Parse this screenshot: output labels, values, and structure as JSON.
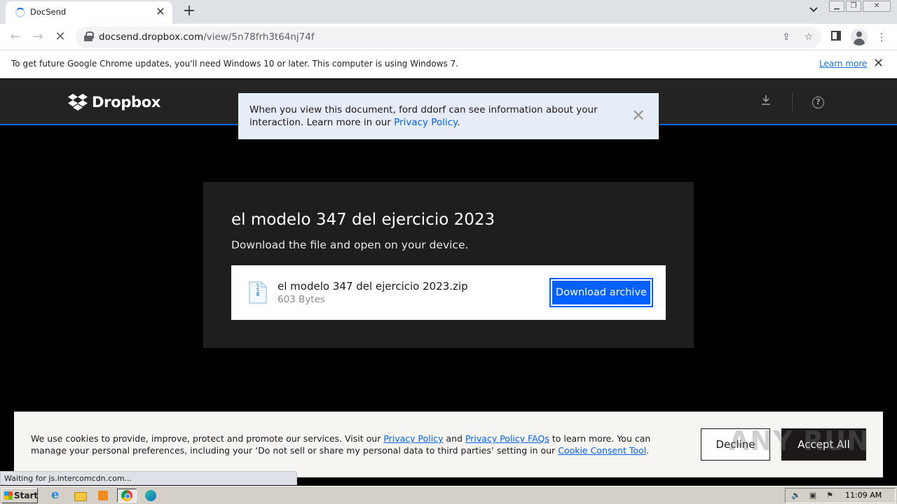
{
  "browser": {
    "tab_title": "DocSend",
    "tab_close": "✕",
    "new_tab": "+",
    "url_host": "docsend.dropbox.com",
    "url_path": "/view/5n78frh3t64nj74f",
    "infobar_message": "To get future Google Chrome updates, you'll need Windows 10 or later. This computer is using Windows 7.",
    "infobar_link": "Learn more",
    "infobar_close": "✕",
    "status_text": "Waiting for js.intercomcdn.com..."
  },
  "header": {
    "brand": "Dropbox",
    "brand_color": "#0061fe"
  },
  "notice": {
    "text": "When you view this document, ford ddorf can see information about your interaction. Learn more in our ",
    "link": "Privacy Policy",
    "end": ".",
    "close": "✕"
  },
  "card": {
    "title": "el modelo 347 del ejercicio 2023",
    "subtitle": "Download the file and open on your device.",
    "file_name": "el modelo 347 del ejercicio 2023.zip",
    "file_size": "603 Bytes",
    "download_button": "Download archive"
  },
  "cookie": {
    "text1": "We use cookies to provide, improve, protect and promote our services. Visit our ",
    "link1": "Privacy Policy",
    "text2": " and ",
    "link2": "Privacy Policy FAQs",
    "text3": " to learn more. You can manage your personal preferences, including your ‘Do not sell or share my personal data to third parties’ setting in our ",
    "link3": "Cookie Consent Tool",
    "text4": ".",
    "decline": "Decline",
    "accept": "Accept All"
  },
  "taskbar": {
    "start": "Start",
    "clock": "11:09 AM"
  },
  "watermark": "ANY RUN"
}
